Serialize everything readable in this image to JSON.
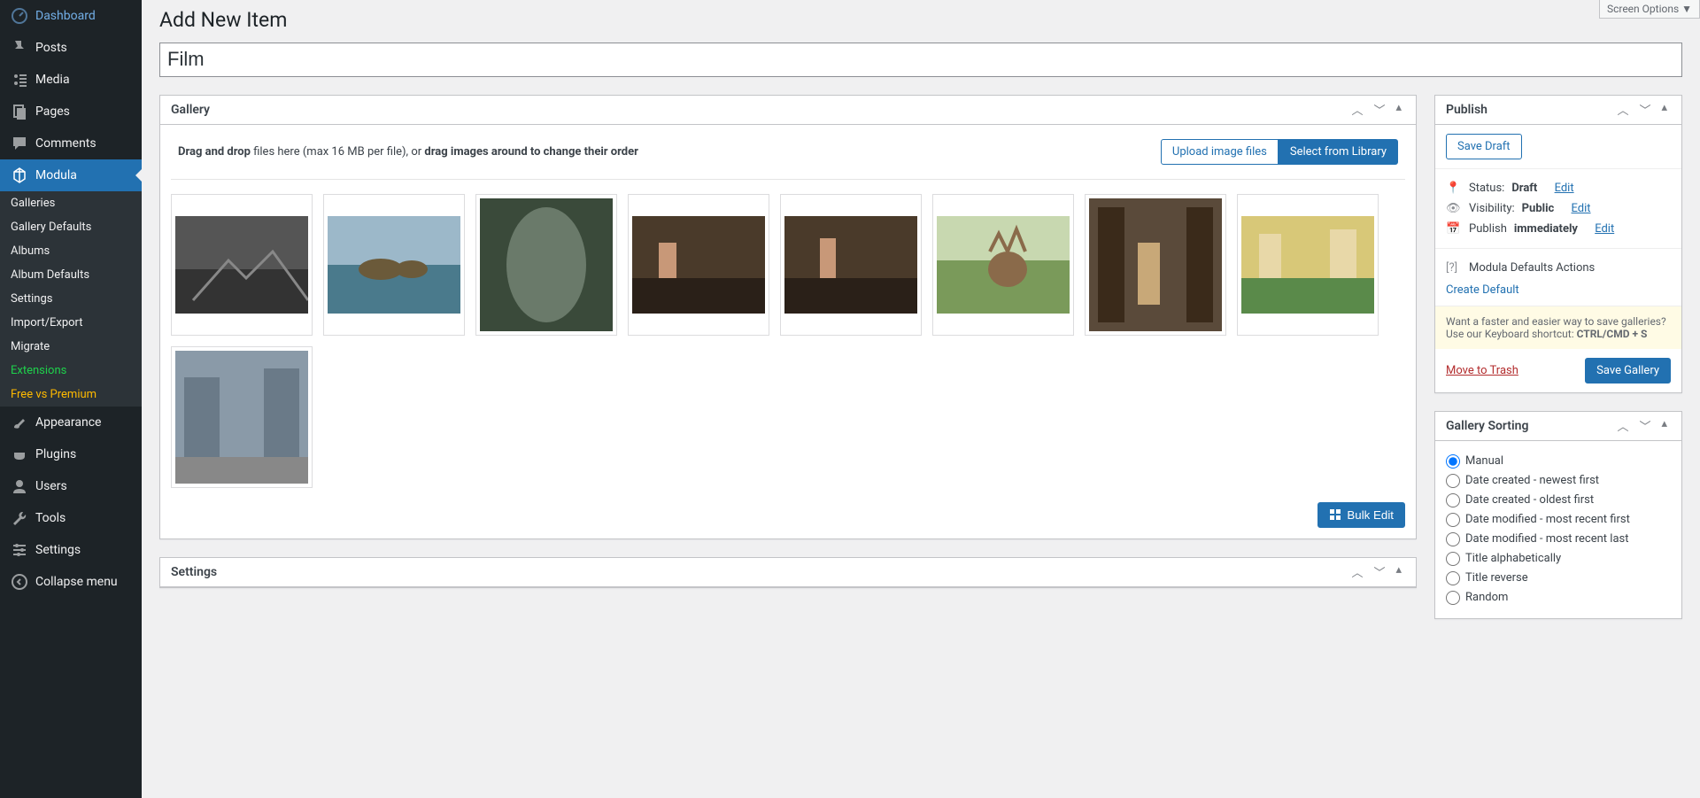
{
  "screen_options": "Screen Options ▼",
  "page_title": "Add New Item",
  "title_value": "Film",
  "sidebar": {
    "items": [
      {
        "label": "Dashboard"
      },
      {
        "label": "Posts"
      },
      {
        "label": "Media"
      },
      {
        "label": "Pages"
      },
      {
        "label": "Comments"
      },
      {
        "label": "Modula"
      },
      {
        "label": "Appearance"
      },
      {
        "label": "Plugins"
      },
      {
        "label": "Users"
      },
      {
        "label": "Tools"
      },
      {
        "label": "Settings"
      },
      {
        "label": "Collapse menu"
      }
    ],
    "submenu": [
      {
        "label": "Galleries"
      },
      {
        "label": "Gallery Defaults"
      },
      {
        "label": "Albums"
      },
      {
        "label": "Album Defaults"
      },
      {
        "label": "Settings"
      },
      {
        "label": "Import/Export"
      },
      {
        "label": "Migrate"
      },
      {
        "label": "Extensions"
      },
      {
        "label": "Free vs Premium"
      }
    ]
  },
  "gallery": {
    "heading": "Gallery",
    "hint_prefix": "Drag and drop ",
    "hint_mid": "files here (max 16 MB per file), or ",
    "hint_suffix": "drag images around to change their order",
    "upload_btn": "Upload image files",
    "library_btn": "Select from Library",
    "bulk_edit": "Bulk Edit",
    "thumbs": [
      {
        "alt": "BW park path"
      },
      {
        "alt": "Coastal rocks"
      },
      {
        "alt": "Oval mirror reflection"
      },
      {
        "alt": "Barista at cafe 1"
      },
      {
        "alt": "Barista at cafe 2"
      },
      {
        "alt": "Deer in park"
      },
      {
        "alt": "Guitarist on steps"
      },
      {
        "alt": "Yellow buildings tram"
      },
      {
        "alt": "City street scene"
      }
    ]
  },
  "settings": {
    "heading": "Settings"
  },
  "publish": {
    "heading": "Publish",
    "save_draft": "Save Draft",
    "status_label": "Status: ",
    "status_value": "Draft",
    "visibility_label": "Visibility: ",
    "visibility_value": "Public",
    "publish_label": "Publish ",
    "publish_value": "immediately",
    "edit": "Edit",
    "defaults_heading": "Modula Defaults Actions",
    "create_default": "Create Default",
    "tip_prefix": "Want a faster and easier way to save galleries? Use our Keyboard shortcut: ",
    "tip_shortcut": "CTRL/CMD + S",
    "trash": "Move to Trash",
    "save_gallery": "Save Gallery"
  },
  "sorting": {
    "heading": "Gallery Sorting",
    "options": [
      {
        "label": "Manual",
        "checked": true
      },
      {
        "label": "Date created - newest first"
      },
      {
        "label": "Date created - oldest first"
      },
      {
        "label": "Date modified - most recent first"
      },
      {
        "label": "Date modified - most recent last"
      },
      {
        "label": "Title alphabetically"
      },
      {
        "label": "Title reverse"
      },
      {
        "label": "Random"
      }
    ]
  }
}
